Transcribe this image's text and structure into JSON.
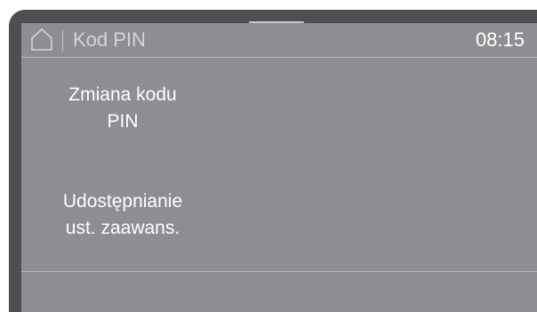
{
  "header": {
    "home_icon": "home-icon",
    "title": "Kod PIN",
    "time": "08:15"
  },
  "menu": {
    "items": [
      {
        "line1": "Zmiana kodu",
        "line2": "PIN"
      },
      {
        "line1": "Udostępnianie",
        "line2": "ust. zaawans."
      }
    ]
  },
  "colors": {
    "bezel": "#4f4f51",
    "screen": "#8d8e91",
    "text": "#ffffff"
  }
}
